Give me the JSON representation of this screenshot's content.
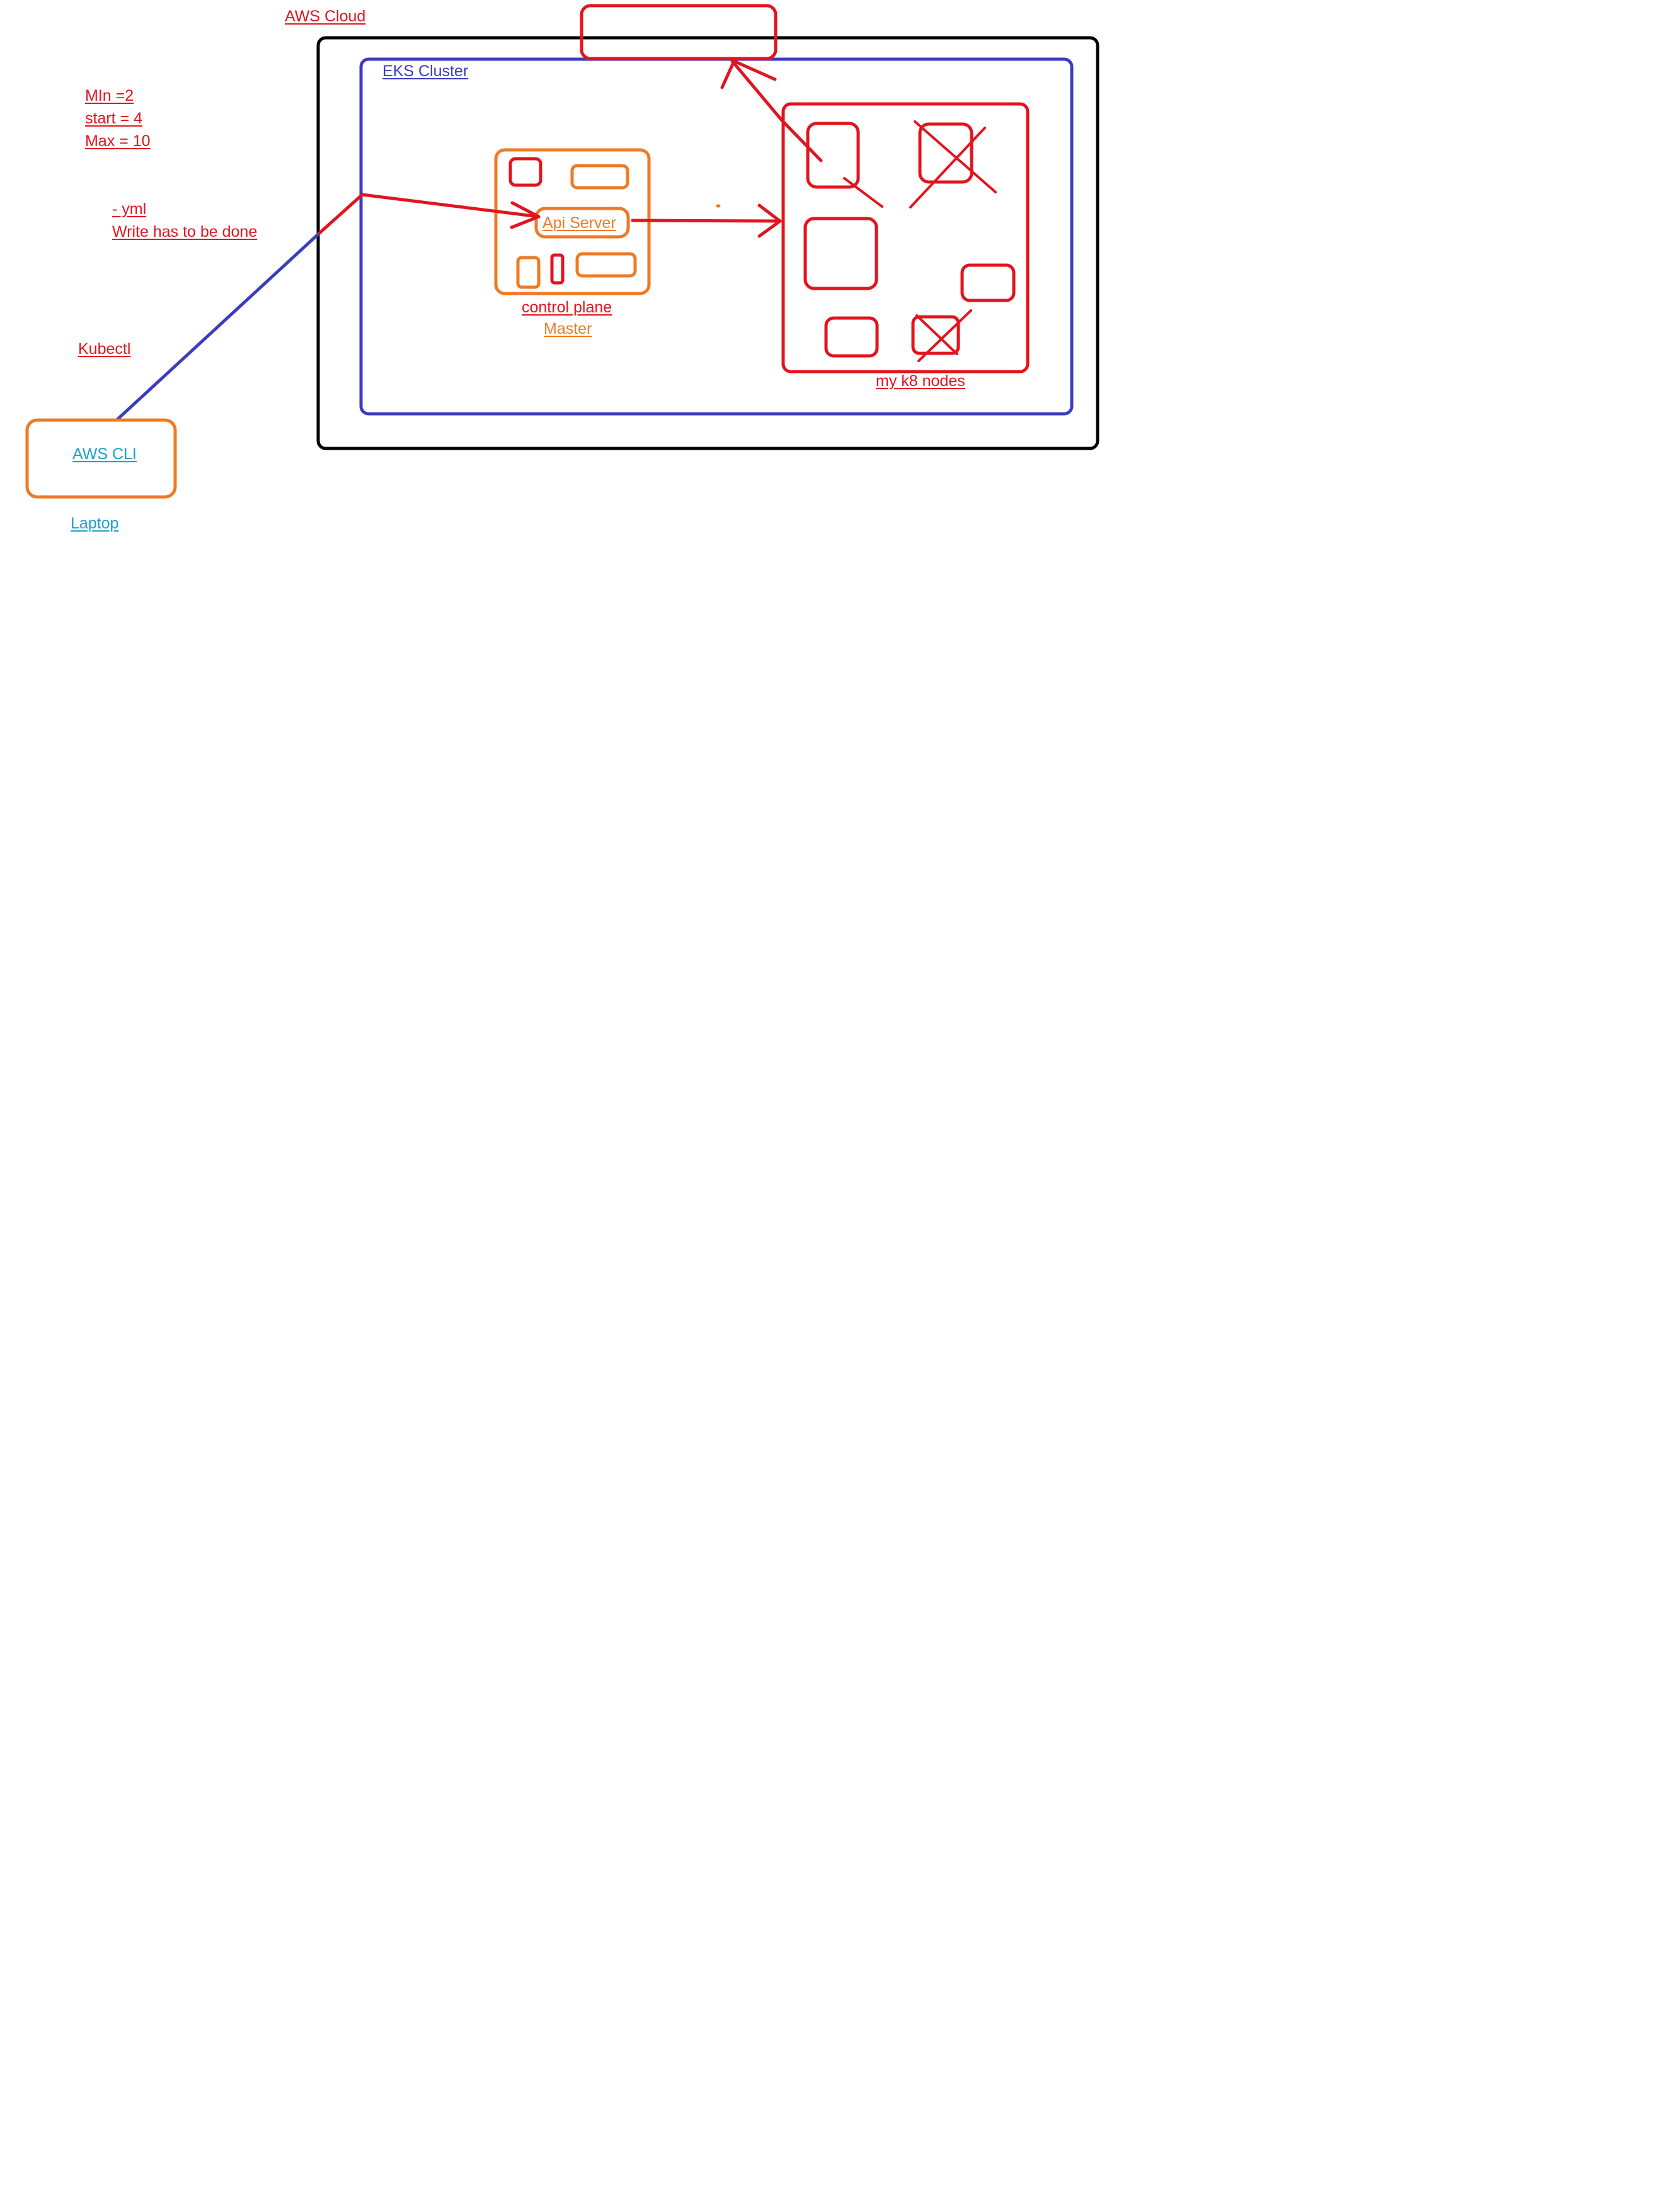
{
  "colors": {
    "red": "#e3141e",
    "blue": "#3b3dbf",
    "orange": "#f07a24",
    "cyan": "#1aa0cf",
    "black": "#000000"
  },
  "labels": {
    "aws_cloud": "AWS  Cloud",
    "eks_cluster": "EKS  Cluster",
    "scaling": [
      "MIn =2",
      "start = 4",
      "Max = 10"
    ],
    "yml": "- yml",
    "write_note": "Write has to be done",
    "kubectl": "Kubectl",
    "aws_cli": "AWS  CLI",
    "laptop": "Laptop",
    "api_server": "Api  Server",
    "control_plane": "control plane",
    "master": "Master",
    "nodes": "my  k8  nodes"
  }
}
